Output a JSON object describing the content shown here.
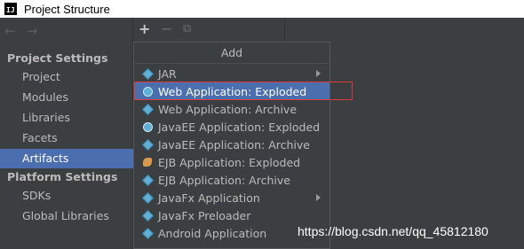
{
  "window": {
    "title": "Project Structure",
    "app_icon_text": "IJ"
  },
  "nav": {
    "back_icon": "arrow-left-icon",
    "forward_icon": "arrow-right-icon"
  },
  "sidebar": {
    "project_settings_title": "Project Settings",
    "project_settings_items": [
      "Project",
      "Modules",
      "Libraries",
      "Facets",
      "Artifacts"
    ],
    "selected_item": "Artifacts",
    "platform_settings_title": "Platform Settings",
    "platform_settings_items": [
      "SDKs",
      "Global Libraries"
    ]
  },
  "toolbar": {
    "add": "+",
    "remove": "−",
    "copy": "⧉"
  },
  "popup": {
    "title": "Add",
    "items": [
      {
        "label": "JAR",
        "icon": "diamond-icon",
        "submenu": true
      },
      {
        "label": "Web Application: Exploded",
        "icon": "globe-icon",
        "submenu": false,
        "highlighted": true
      },
      {
        "label": "Web Application: Archive",
        "icon": "diamond-icon",
        "submenu": false
      },
      {
        "label": "JavaEE Application: Exploded",
        "icon": "globe-icon",
        "submenu": false
      },
      {
        "label": "JavaEE Application: Archive",
        "icon": "diamond-icon",
        "submenu": false
      },
      {
        "label": "EJB Application: Exploded",
        "icon": "bean-icon",
        "submenu": false
      },
      {
        "label": "EJB Application: Archive",
        "icon": "diamond-icon",
        "submenu": false
      },
      {
        "label": "JavaFx Application",
        "icon": "diamond-icon",
        "submenu": true
      },
      {
        "label": "JavaFx Preloader",
        "icon": "diamond-icon",
        "submenu": false
      },
      {
        "label": "Android Application",
        "icon": "diamond-icon",
        "submenu": false
      }
    ]
  },
  "watermark": "https://blog.csdn.net/qq_45812180",
  "colors": {
    "selection": "#4b6eaf",
    "background": "#3c3f41",
    "annotation_box": "#e03b3b"
  }
}
